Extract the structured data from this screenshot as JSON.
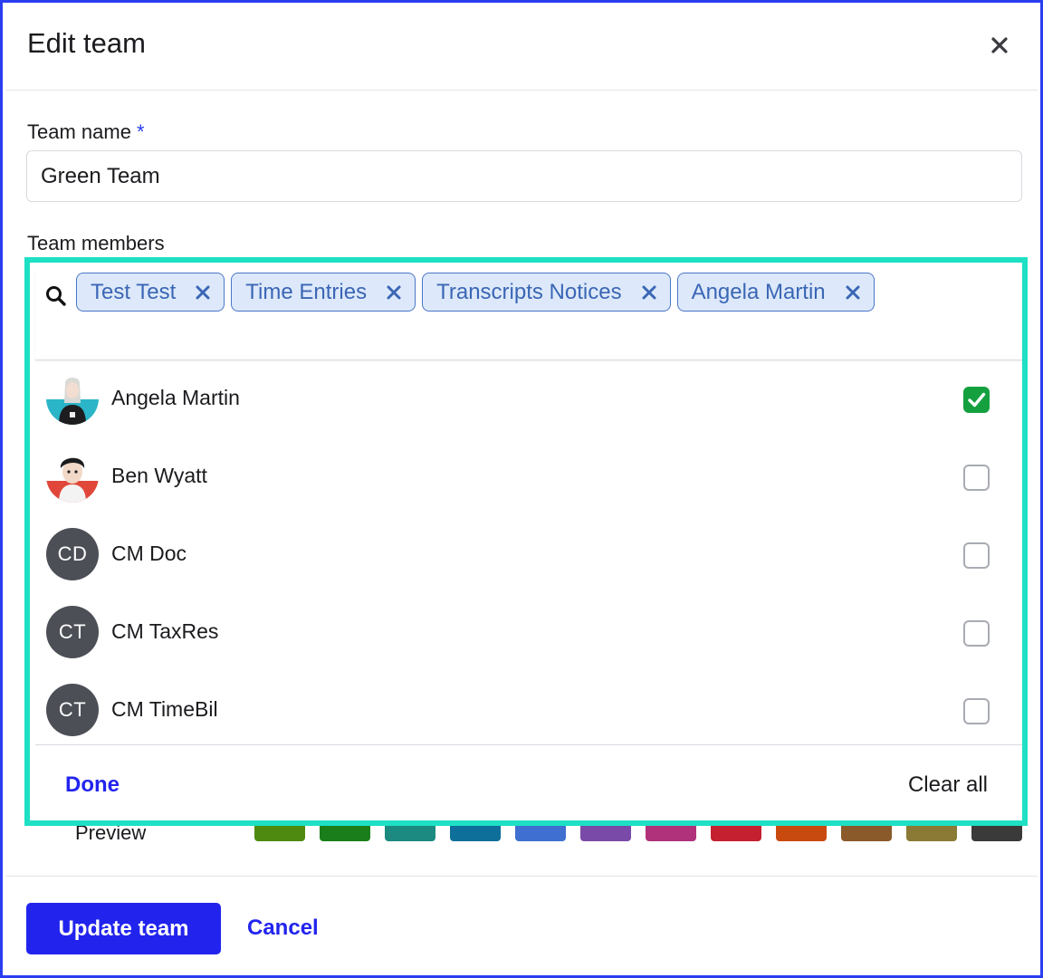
{
  "dialog": {
    "title": "Edit team"
  },
  "form": {
    "team_name_label": "Team name",
    "required_marker": "*",
    "team_name_value": "Green Team",
    "team_members_label": "Team members",
    "preview_label": "Preview"
  },
  "picker": {
    "selected_chips": [
      {
        "label": "Test Test"
      },
      {
        "label": "Time Entries"
      },
      {
        "label": "Transcripts Notices"
      },
      {
        "label": "Angela Martin"
      }
    ],
    "members": [
      {
        "name": "Angela Martin",
        "avatar": "photo-angela-martin",
        "checked": true
      },
      {
        "name": "Ben Wyatt",
        "avatar": "photo-ben-wyatt",
        "checked": false
      },
      {
        "name": "CM Doc",
        "initials": "CD",
        "checked": false
      },
      {
        "name": "CM TaxRes",
        "initials": "CT",
        "checked": false
      },
      {
        "name": "CM TimeBil",
        "initials": "CT",
        "checked": false
      }
    ],
    "done_label": "Done",
    "clear_all_label": "Clear all"
  },
  "colors": {
    "accent": "#2224ee",
    "highlight": "#1ee0c4",
    "chip_bg": "#dde9fa",
    "chip_text": "#3a66b5",
    "checked": "#15a040",
    "swatches": [
      "#4f8a10",
      "#1a7f1a",
      "#1c8a80",
      "#0e6f9a",
      "#3f6fd0",
      "#7a4aa8",
      "#b0327a",
      "#c42030",
      "#c94a0f",
      "#8a5a2a",
      "#8a7a35",
      "#3a3a3a"
    ]
  },
  "footer": {
    "update_label": "Update team",
    "cancel_label": "Cancel"
  }
}
